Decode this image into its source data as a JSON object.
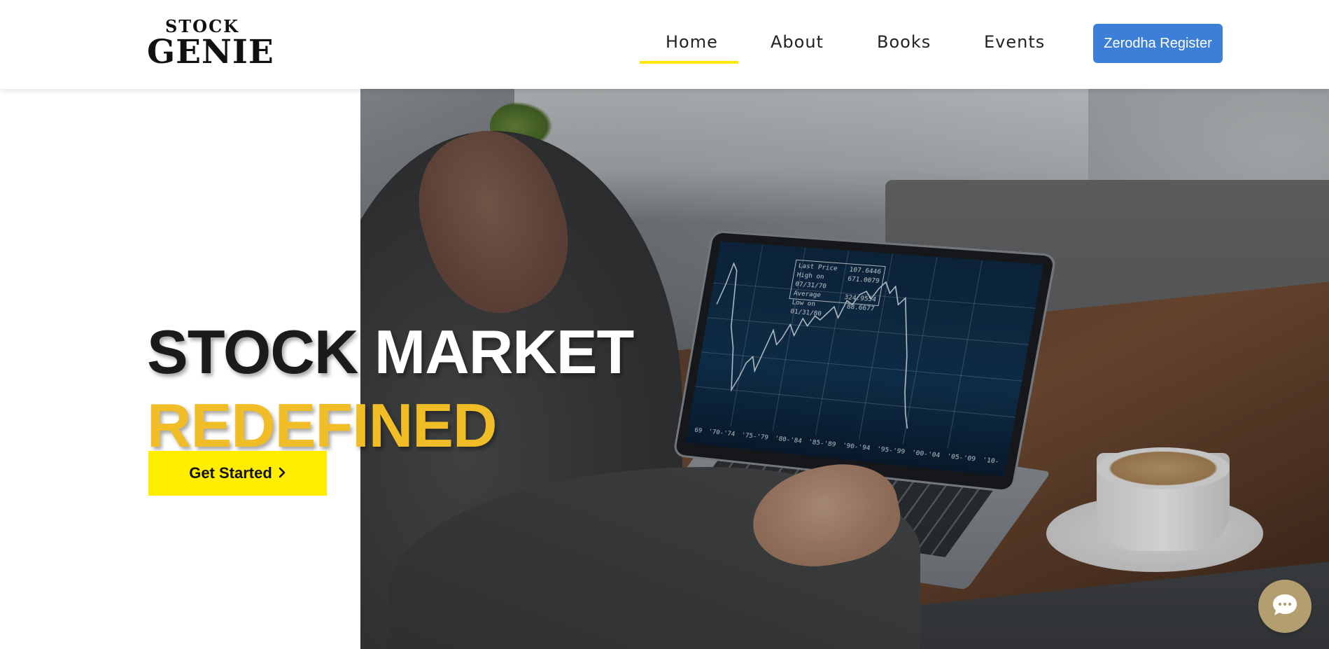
{
  "brand": {
    "logo_small": "STOCK",
    "logo_big": "GENIE"
  },
  "nav": {
    "items": [
      {
        "label": "Home",
        "active": true
      },
      {
        "label": "About"
      },
      {
        "label": "Books"
      },
      {
        "label": "Events"
      }
    ],
    "register_label": "Zerodha Register"
  },
  "hero": {
    "title_word_1": "STOCK",
    "title_word_2": "MARKET",
    "title_line_2": "REDEFINED",
    "cta_label": "Get Started",
    "cta_icon": "chevron-right-icon"
  },
  "screen": {
    "legend": [
      {
        "label": "Last Price",
        "value": "107.6446"
      },
      {
        "label": "High on 07/31/70",
        "value": "671.0079"
      },
      {
        "label": "Average",
        "value": "324.9554"
      },
      {
        "label": "Low on 01/31/80",
        "value": "88.6677"
      }
    ],
    "ticks": [
      "69",
      "'70-'74",
      "'75-'79",
      "'80-'84",
      "'85-'89",
      "'90-'94",
      "'95-'99",
      "'00-'04",
      "'05-'09",
      "'10-"
    ]
  },
  "chat": {
    "icon": "chat-bubble-icon"
  },
  "colors": {
    "accent_yellow": "#ffee00",
    "title_yellow": "#f0bd27",
    "register_blue": "#3d7fd6",
    "chat_bg": "#b29e6f"
  }
}
